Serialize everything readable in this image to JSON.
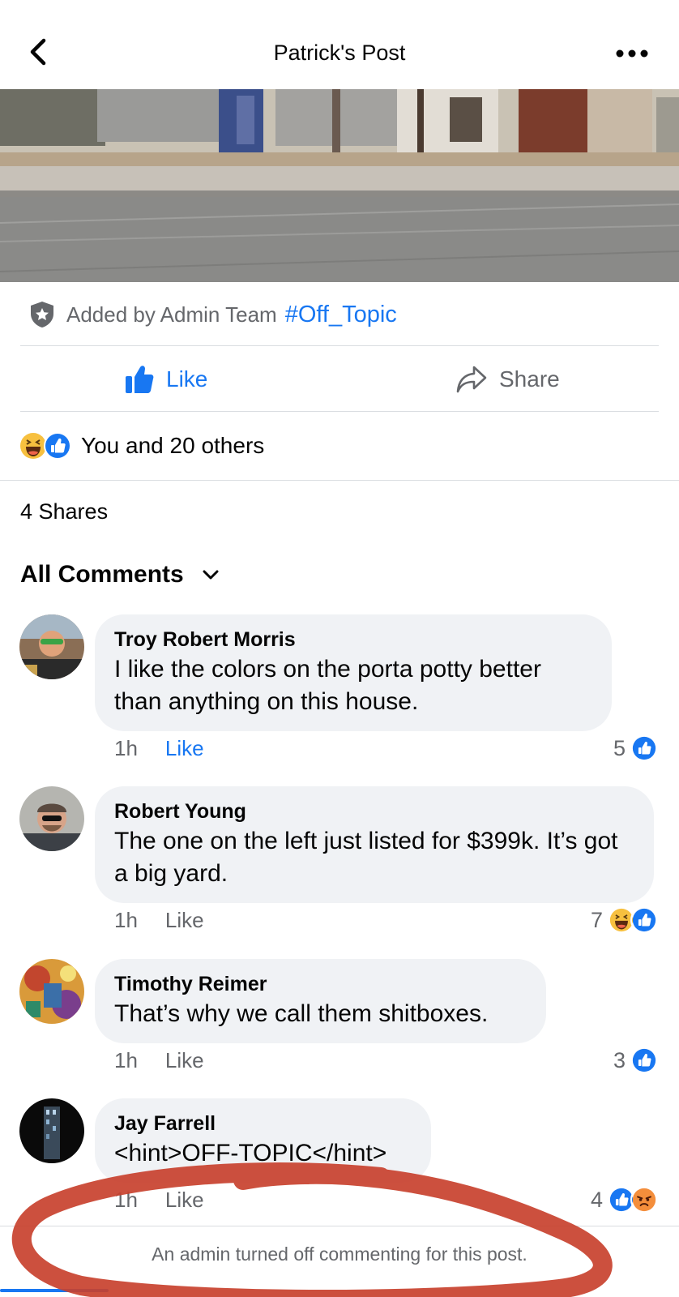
{
  "header": {
    "title": "Patrick's Post"
  },
  "post": {
    "added_by": "Added by Admin Team",
    "topic": "#Off_Topic",
    "like_label": "Like",
    "share_label": "Share",
    "reaction_summary": "You and 20 others",
    "shares": "4 Shares",
    "comments_filter": "All Comments"
  },
  "comments": [
    {
      "name": "Troy Robert Morris",
      "text": "I like the colors on the porta potty better than anything on this house.",
      "time": "1h",
      "like": "Like",
      "liked": true,
      "reaction_count": "5",
      "reactions": [
        "like-icon"
      ]
    },
    {
      "name": "Robert Young",
      "text": "The one on the left just listed for $399k. It’s got a big yard.",
      "time": "1h",
      "like": "Like",
      "liked": false,
      "reaction_count": "7",
      "reactions": [
        "haha-icon",
        "like-icon"
      ]
    },
    {
      "name": "Timothy Reimer",
      "text": "That’s why we call them shitboxes.",
      "time": "1h",
      "like": "Like",
      "liked": false,
      "reaction_count": "3",
      "reactions": [
        "like-icon"
      ]
    },
    {
      "name": "Jay Farrell",
      "text": "<hint>OFF-TOPIC</hint>",
      "time": "1h",
      "like": "Like",
      "liked": false,
      "reaction_count": "4",
      "reactions": [
        "like-icon",
        "angry-icon"
      ]
    }
  ],
  "footer": {
    "notice": "An admin turned off commenting for this post."
  },
  "colors": {
    "accent": "#1877f2",
    "secondary_text": "#65676b",
    "bubble": "#f0f2f5",
    "annotation": "#c8412e"
  }
}
